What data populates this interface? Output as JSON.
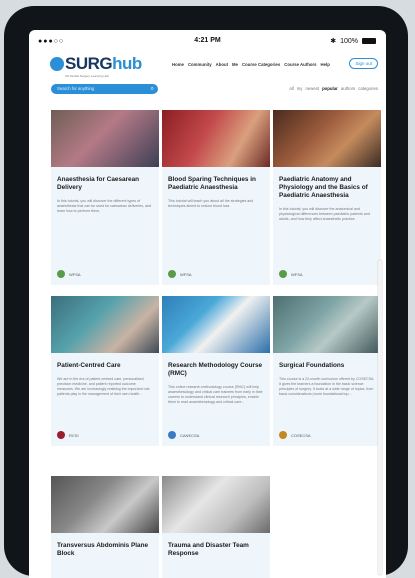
{
  "status": {
    "signal": "●●●○○",
    "time": "4:21 PM",
    "battery": "100%"
  },
  "brand": {
    "prefix": "SURG",
    "suffix": "hub",
    "tagline": "UN Global Surgery Learning Hub"
  },
  "nav": {
    "links": [
      "Home",
      "Community",
      "About",
      "Me",
      "Course Categories",
      "Course Authors",
      "Help"
    ],
    "signout": "Sign out"
  },
  "search": {
    "placeholder": "Search for anything"
  },
  "filters": [
    "all",
    "my",
    "newest",
    "popular",
    "authors",
    "categories"
  ],
  "colors": {
    "accent": "#2a8fd6",
    "card_bg": "#eef6fb"
  },
  "cards": [
    {
      "title": "Anaesthesia for Caesarean Delivery",
      "desc": "In this tutorial, you will discover the different types of anaesthesia that can be used for caesarean deliveries, and learn how to perform them.",
      "provider": "WFSA",
      "icon": "wfsa-icon"
    },
    {
      "title": "Blood Sparing Techniques in Paediatric Anaesthesia",
      "desc": "This tutorial will teach you about all the strategies and techniques aimed to reduce blood loss.",
      "provider": "WFSA",
      "icon": "wfsa-icon"
    },
    {
      "title": "Paediatric Anatomy and Physiology and the Basics of Paediatric Anaesthesia",
      "desc": "In this tutorial, you will discover the anatomical and physiological differences between paediatric patients and adults, and how they affect anaesthetic practice.",
      "provider": "WFSA",
      "icon": "wfsa-icon"
    },
    {
      "title": "Patient-Centred Care",
      "desc": "We are in the era of patient centred care, personalised precision medicine, and patient reported outcome measures. We are increasingly realising the important role patients play in the management of their own health...",
      "provider": "RCSI",
      "icon": "rcsi-icon"
    },
    {
      "title": "Research Methodology Course (RMC)",
      "desc": "This online research methodology course (RMC) will help anaesthesiology and critical care trainees from early in their careers to understand clinical research principles, enable them to read anaesthesiology and critical care...",
      "provider": "CANECSA",
      "icon": "canecsa-icon"
    },
    {
      "title": "Surgical Foundations",
      "desc": "This course is a 22-month curriculum offered by COSECSA. It gives the learners a foundation in the basic science principles of surgery. It looks at a wide range of topics, from basic considerations (more foundational top...",
      "provider": "COSECSA",
      "icon": "cosecsa-icon"
    },
    {
      "title": "Transversus Abdominis Plane Block",
      "desc": "",
      "provider": "",
      "icon": ""
    },
    {
      "title": "Trauma and Disaster Team Response",
      "desc": "",
      "provider": "",
      "icon": ""
    }
  ]
}
